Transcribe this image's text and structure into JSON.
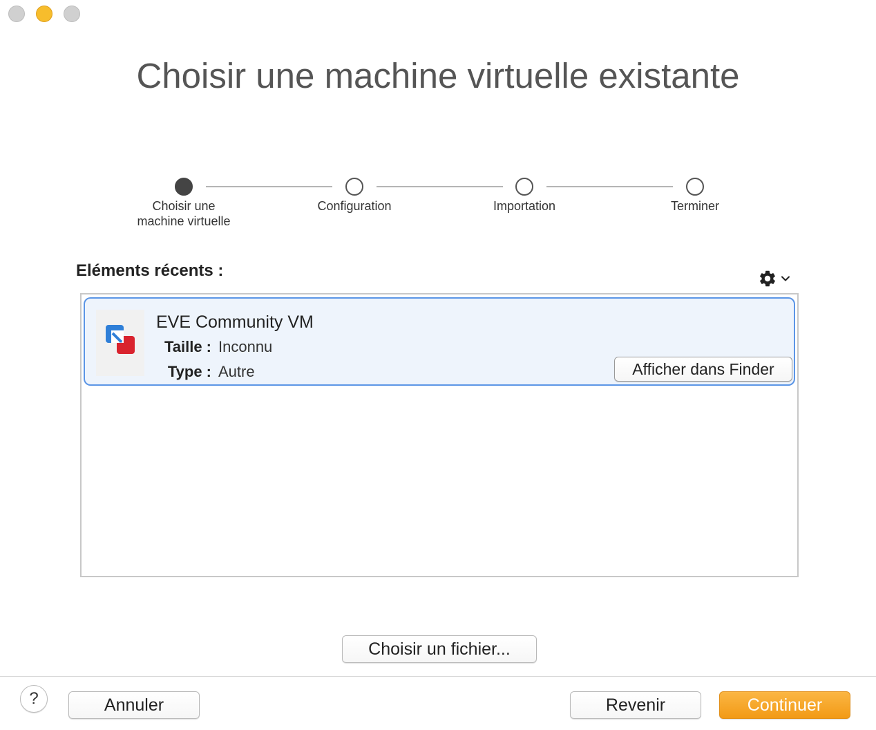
{
  "window": {
    "traffic_lights": [
      "close",
      "minimize",
      "zoom"
    ]
  },
  "title": "Choisir une machine virtuelle existante",
  "stepper": {
    "steps": [
      {
        "label": "Choisir une\nmachine virtuelle",
        "state": "active"
      },
      {
        "label": "Configuration",
        "state": "pending"
      },
      {
        "label": "Importation",
        "state": "pending"
      },
      {
        "label": "Terminer",
        "state": "pending"
      }
    ]
  },
  "recent": {
    "label": "Eléments récents :",
    "settings_icon": "gear-icon",
    "items": [
      {
        "name": "EVE Community VM",
        "size_label": "Taille :",
        "size_value": "Inconnu",
        "type_label": "Type :",
        "type_value": "Autre",
        "finder_button": "Afficher dans Finder",
        "icon": "vmware-fusion-icon"
      }
    ]
  },
  "choose_file_button": "Choisir un fichier...",
  "footer": {
    "help": "?",
    "cancel": "Annuler",
    "back": "Revenir",
    "continue": "Continuer"
  },
  "colors": {
    "accent": "#f29a16",
    "selection_border": "#5b95e6",
    "selection_bg": "#eef4fc"
  }
}
